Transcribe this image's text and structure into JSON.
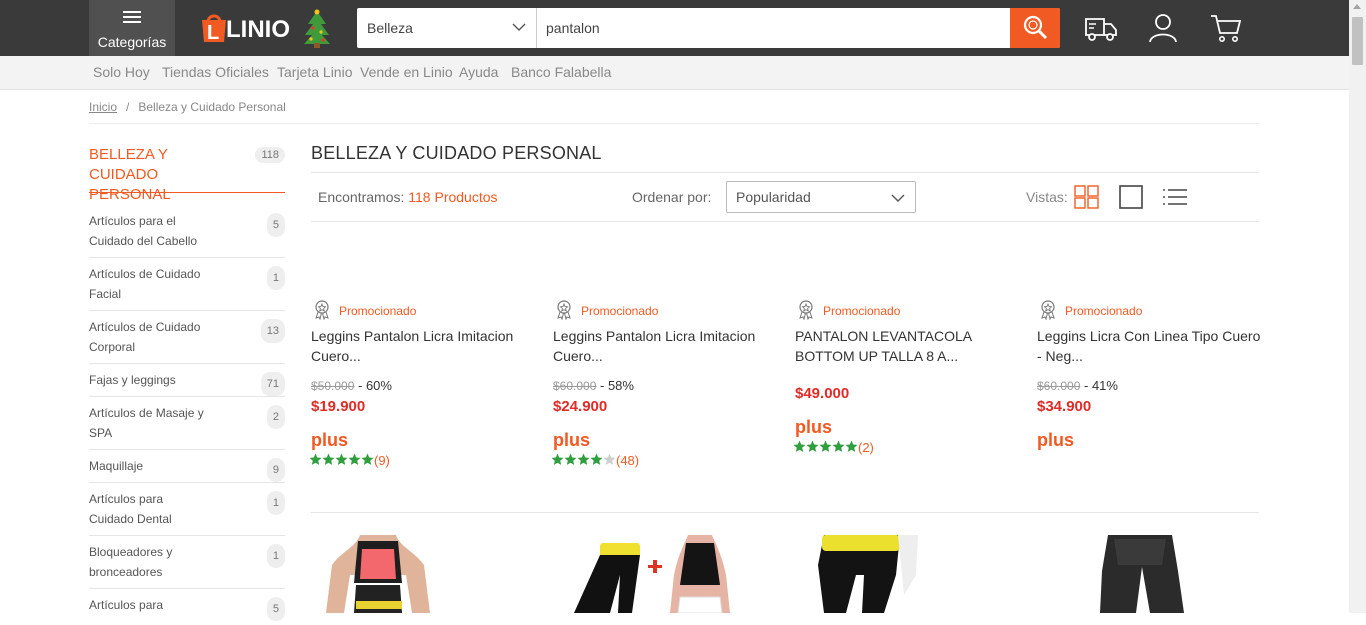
{
  "header": {
    "categories_label": "Categorías",
    "logo_text": "LINIO",
    "search": {
      "department": "Belleza",
      "query": "pantalon"
    }
  },
  "subnav": [
    "Solo Hoy",
    "Tiendas Oficiales",
    "Tarjeta Linio",
    "Vende en Linio",
    "Ayuda",
    "Banco Falabella"
  ],
  "breadcrumb": {
    "home": "Inicio",
    "separator": "/",
    "current": "Belleza y Cuidado Personal"
  },
  "sidebar": {
    "title": "BELLEZA Y CUIDADO PERSONAL",
    "title_count": "118",
    "items": [
      {
        "label": "Artículos para el Cuidado del Cabello",
        "count": "5"
      },
      {
        "label": "Artículos de Cuidado Facial",
        "count": "1"
      },
      {
        "label": "Artículos de Cuidado Corporal",
        "count": "13"
      },
      {
        "label": "Fajas y leggings",
        "count": "71"
      },
      {
        "label": "Artículos de Masaje y SPA",
        "count": "2"
      },
      {
        "label": "Maquillaje",
        "count": "9"
      },
      {
        "label": "Artículos para Cuidado Dental",
        "count": "1"
      },
      {
        "label": "Bloqueadores y bronceadores",
        "count": "1"
      },
      {
        "label": "Artículos para",
        "count": "5"
      }
    ]
  },
  "main": {
    "title": "BELLEZA Y CUIDADO PERSONAL",
    "found_prefix": "Encontramos:",
    "found_count": "118 Productos",
    "order_label": "Ordenar por:",
    "order_value": "Popularidad",
    "views_label": "Vistas:"
  },
  "products": [
    {
      "promo": "Promocionado",
      "name": "Leggins Pantalon Licra Imitacion Cuero...",
      "old_price": "$50.000",
      "discount": " - 60%",
      "price": "$19.900",
      "plus": "plus",
      "stars": 5,
      "reviews": "(9)"
    },
    {
      "promo": "Promocionado",
      "name": "Leggins Pantalon Licra Imitacion Cuero...",
      "old_price": "$60.000",
      "discount": " - 58%",
      "price": "$24.900",
      "plus": "plus",
      "stars": 4,
      "reviews": "(48)"
    },
    {
      "promo": "Promocionado",
      "name": "PANTALON LEVANTACOLA BOTTOM UP TALLA 8 A...",
      "old_price": "",
      "discount": "",
      "price": "$49.000",
      "plus": "plus",
      "stars": 5,
      "reviews": "(2)"
    },
    {
      "promo": "Promocionado",
      "name": "Leggins Licra Con Linea Tipo Cuero - Neg...",
      "old_price": "$60.000",
      "discount": " - 41%",
      "price": "$34.900",
      "plus": "plus",
      "stars": 0,
      "reviews": ""
    }
  ],
  "colors": {
    "accent": "#f15a22",
    "price": "#e02b27",
    "star": "#2e9e3e",
    "topbar": "#3a3a3a"
  }
}
